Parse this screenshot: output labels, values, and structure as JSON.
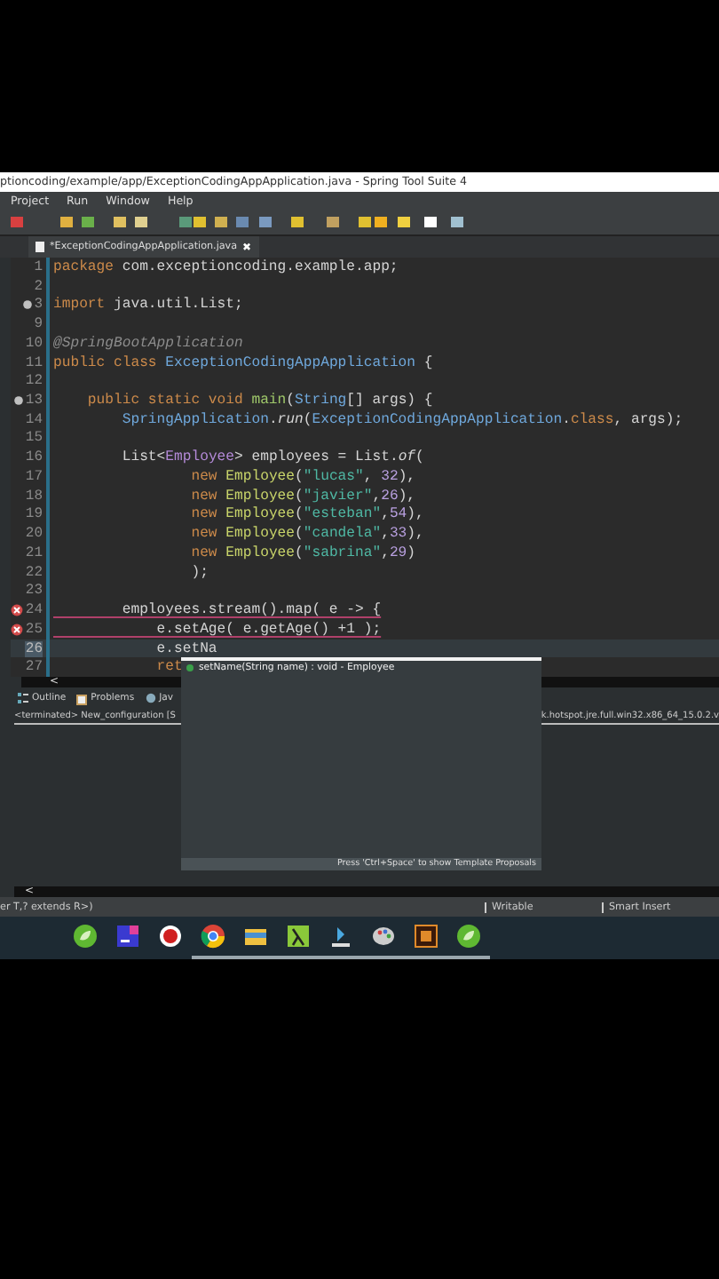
{
  "window": {
    "title": "ptioncoding/example/app/ExceptionCodingAppApplication.java - Spring Tool Suite 4"
  },
  "menu": [
    "Project",
    "Run",
    "Window",
    "Help"
  ],
  "editor_tab": {
    "label": "*ExceptionCodingAppApplication.java",
    "close": "✖"
  },
  "code": [
    {
      "number": "1",
      "error": false,
      "foldable": false,
      "current": false,
      "tokens": [
        {
          "kind": "kw",
          "text": "package "
        },
        {
          "kind": "plain",
          "text": "com.exceptioncoding.example.app;"
        }
      ]
    },
    {
      "number": "2",
      "error": false,
      "foldable": false,
      "current": false
    },
    {
      "number": "3",
      "error": false,
      "foldable": true,
      "current": false,
      "tokens": [
        {
          "kind": "kw",
          "text": "import "
        },
        {
          "kind": "plain",
          "text": "java.util.List;"
        }
      ]
    },
    {
      "number": "9",
      "error": false,
      "foldable": false,
      "current": false
    },
    {
      "number": "10",
      "error": false,
      "foldable": false,
      "current": false,
      "tokens": [
        {
          "kind": "ann",
          "text": "@SpringBootApplication"
        }
      ]
    },
    {
      "number": "11",
      "error": false,
      "foldable": false,
      "current": false,
      "tokens": [
        {
          "kind": "kw",
          "text": "public class "
        },
        {
          "kind": "type",
          "text": "ExceptionCodingAppApplication"
        },
        {
          "kind": "plain",
          "text": " {"
        }
      ]
    },
    {
      "number": "12",
      "error": false,
      "foldable": false,
      "current": false
    },
    {
      "number": "13",
      "error": false,
      "foldable": true,
      "current": false,
      "tokens": [
        {
          "kind": "kw",
          "text": "    public static void "
        },
        {
          "kind": "fn",
          "text": "main"
        },
        {
          "kind": "plain",
          "text": "("
        },
        {
          "kind": "type",
          "text": "String"
        },
        {
          "kind": "plain",
          "text": "[] args) {"
        }
      ]
    },
    {
      "number": "14",
      "error": false,
      "foldable": false,
      "current": false,
      "tokens": [
        {
          "kind": "type",
          "text": "        SpringApplication"
        },
        {
          "kind": "plain",
          "text": "."
        },
        {
          "kind": "ital",
          "text": "run"
        },
        {
          "kind": "plain",
          "text": "("
        },
        {
          "kind": "type",
          "text": "ExceptionCodingAppApplication"
        },
        {
          "kind": "plain",
          "text": "."
        },
        {
          "kind": "kw",
          "text": "class"
        },
        {
          "kind": "plain",
          "text": ", args);"
        }
      ]
    },
    {
      "number": "15",
      "error": false,
      "foldable": false,
      "current": false
    },
    {
      "number": "16",
      "error": false,
      "foldable": false,
      "current": false,
      "tokens": [
        {
          "kind": "plain",
          "text": "        List<"
        },
        {
          "kind": "gen",
          "text": "Employee"
        },
        {
          "kind": "plain",
          "text": "> employees = List."
        },
        {
          "kind": "ital",
          "text": "of"
        },
        {
          "kind": "plain",
          "text": "("
        }
      ]
    },
    {
      "number": "17",
      "error": false,
      "foldable": false,
      "current": false,
      "tokens": [
        {
          "kind": "kw",
          "text": "                new "
        },
        {
          "kind": "cls",
          "text": "Employee"
        },
        {
          "kind": "plain",
          "text": "("
        },
        {
          "kind": "str",
          "text": "\"lucas\""
        },
        {
          "kind": "plain",
          "text": ", "
        },
        {
          "kind": "num",
          "text": "32"
        },
        {
          "kind": "plain",
          "text": "),"
        }
      ]
    },
    {
      "number": "18",
      "error": false,
      "foldable": false,
      "current": false,
      "tokens": [
        {
          "kind": "kw",
          "text": "                new "
        },
        {
          "kind": "cls",
          "text": "Employee"
        },
        {
          "kind": "plain",
          "text": "("
        },
        {
          "kind": "str",
          "text": "\"javier\""
        },
        {
          "kind": "plain",
          "text": ","
        },
        {
          "kind": "num",
          "text": "26"
        },
        {
          "kind": "plain",
          "text": "),"
        }
      ]
    },
    {
      "number": "19",
      "error": false,
      "foldable": false,
      "current": false,
      "tokens": [
        {
          "kind": "kw",
          "text": "                new "
        },
        {
          "kind": "cls",
          "text": "Employee"
        },
        {
          "kind": "plain",
          "text": "("
        },
        {
          "kind": "str",
          "text": "\"esteban\""
        },
        {
          "kind": "plain",
          "text": ","
        },
        {
          "kind": "num",
          "text": "54"
        },
        {
          "kind": "plain",
          "text": "),"
        }
      ]
    },
    {
      "number": "20",
      "error": false,
      "foldable": false,
      "current": false,
      "tokens": [
        {
          "kind": "kw",
          "text": "                new "
        },
        {
          "kind": "cls",
          "text": "Employee"
        },
        {
          "kind": "plain",
          "text": "("
        },
        {
          "kind": "str",
          "text": "\"candela\""
        },
        {
          "kind": "plain",
          "text": ","
        },
        {
          "kind": "num",
          "text": "33"
        },
        {
          "kind": "plain",
          "text": "),"
        }
      ]
    },
    {
      "number": "21",
      "error": false,
      "foldable": false,
      "current": false,
      "tokens": [
        {
          "kind": "kw",
          "text": "                new "
        },
        {
          "kind": "cls",
          "text": "Employee"
        },
        {
          "kind": "plain",
          "text": "("
        },
        {
          "kind": "str",
          "text": "\"sabrina\""
        },
        {
          "kind": "plain",
          "text": ","
        },
        {
          "kind": "num",
          "text": "29"
        },
        {
          "kind": "plain",
          "text": ")"
        }
      ]
    },
    {
      "number": "22",
      "error": false,
      "foldable": false,
      "current": false,
      "tokens": [
        {
          "kind": "plain",
          "text": "                );"
        }
      ]
    },
    {
      "number": "23",
      "error": false,
      "foldable": false,
      "current": false
    },
    {
      "number": "24",
      "error": true,
      "foldable": false,
      "current": false,
      "tokens": [
        {
          "kind": "plain",
          "text": "        employees.stream().map( e -> {"
        }
      ]
    },
    {
      "number": "25",
      "error": true,
      "foldable": false,
      "current": false,
      "tokens": [
        {
          "kind": "plain",
          "text": "            e.setAge( e.getAge() +1 );"
        }
      ]
    },
    {
      "number": "26",
      "error": false,
      "foldable": false,
      "current": true,
      "tokens": [
        {
          "kind": "plain",
          "text": "            e.setNa"
        }
      ]
    },
    {
      "number": "27",
      "error": false,
      "foldable": false,
      "current": false,
      "tokens": [
        {
          "kind": "kw",
          "text": "            ret"
        }
      ]
    }
  ],
  "editor_scroll": "<",
  "panel_tabs": [
    {
      "label": "Outline"
    },
    {
      "label": "Problems"
    },
    {
      "label": "Jav"
    }
  ],
  "console": {
    "left": "<terminated> New_configuration [S",
    "right": "k.hotspot.jre.full.win32.x86_64_15.0.2.v"
  },
  "console_scroll": "<",
  "completion": {
    "items": [
      {
        "text": "setName(String name) : void - Employee",
        "selected": false
      }
    ],
    "footer": "Press 'Ctrl+Space' to show Template Proposals"
  },
  "status_bar": {
    "hint": "er T,? extends R>)",
    "mode": "Writable",
    "insert": "Smart Insert"
  },
  "taskbar": [
    {
      "kind": "leaf",
      "open": false
    },
    {
      "kind": "ide",
      "open": false
    },
    {
      "kind": "record",
      "open": false
    },
    {
      "kind": "browser",
      "open": true
    },
    {
      "kind": "folder",
      "open": true
    },
    {
      "kind": "lambda",
      "open": true
    },
    {
      "kind": "download",
      "open": true
    },
    {
      "kind": "paint",
      "open": true
    },
    {
      "kind": "ai",
      "open": true
    },
    {
      "kind": "leaf",
      "open": true
    }
  ]
}
